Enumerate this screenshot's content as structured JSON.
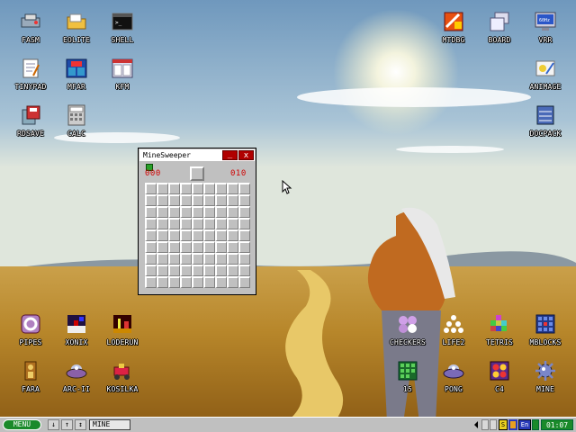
{
  "desktop": {
    "icons_left": [
      {
        "label": "FASM",
        "icon": "fasm-icon"
      },
      {
        "label": "EOLITE",
        "icon": "folder-icon"
      },
      {
        "label": "SHELL",
        "icon": "shell-icon"
      },
      {
        "label": "TINYPAD",
        "icon": "notepad-icon"
      },
      {
        "label": "MFAR",
        "icon": "file-manager-icon"
      },
      {
        "label": "KFM",
        "icon": "file-manager-icon"
      },
      {
        "label": "RDSAVE",
        "icon": "ramdisk-save-icon"
      },
      {
        "label": "CALC",
        "icon": "calculator-icon"
      }
    ],
    "icons_right": [
      {
        "label": "MTDBG",
        "icon": "debugger-icon"
      },
      {
        "label": "BOARD",
        "icon": "board-icon"
      },
      {
        "label": "VRR",
        "icon": "monitor-icon"
      },
      {
        "label": "ANIMAGE",
        "icon": "paint-icon"
      },
      {
        "label": "DOCPACK",
        "icon": "docpack-icon"
      }
    ],
    "icons_games": [
      {
        "label": "PIPES",
        "icon": "pipes-icon"
      },
      {
        "label": "XONIX",
        "icon": "xonix-icon"
      },
      {
        "label": "LODERUN",
        "icon": "loderun-icon"
      },
      {
        "label": "FARA",
        "icon": "fara-icon"
      },
      {
        "label": "ARC-II",
        "icon": "ufo-icon"
      },
      {
        "label": "KOSILKA",
        "icon": "mower-icon"
      },
      {
        "label": "CHECKERS",
        "icon": "checkers-icon"
      },
      {
        "label": "LIFE2",
        "icon": "life-icon"
      },
      {
        "label": "TETRIS",
        "icon": "tetris-icon"
      },
      {
        "label": "MBLOCKS",
        "icon": "blocks-icon"
      },
      {
        "label": "15",
        "icon": "fifteen-puzzle-icon"
      },
      {
        "label": "PONG",
        "icon": "ufo-icon"
      },
      {
        "label": "C4",
        "icon": "connect-four-icon"
      },
      {
        "label": "MINE",
        "icon": "mine-icon"
      }
    ]
  },
  "window": {
    "title": "MineSweeper",
    "minimize": "_",
    "close": "x",
    "mines_left": "000",
    "timer": "010",
    "rows": 9,
    "cols": 9
  },
  "taskbar": {
    "menu_label": "MENU",
    "btn_down": "↓",
    "btn_up": "↑",
    "btn_updown": "↕",
    "task_label": "MINE",
    "tray_a": "S",
    "tray_lang": "En",
    "clock": "01:07"
  },
  "colors": {
    "accent_green": "#1a8a2a",
    "title_red": "#b00000",
    "counter_red": "#d00000"
  }
}
